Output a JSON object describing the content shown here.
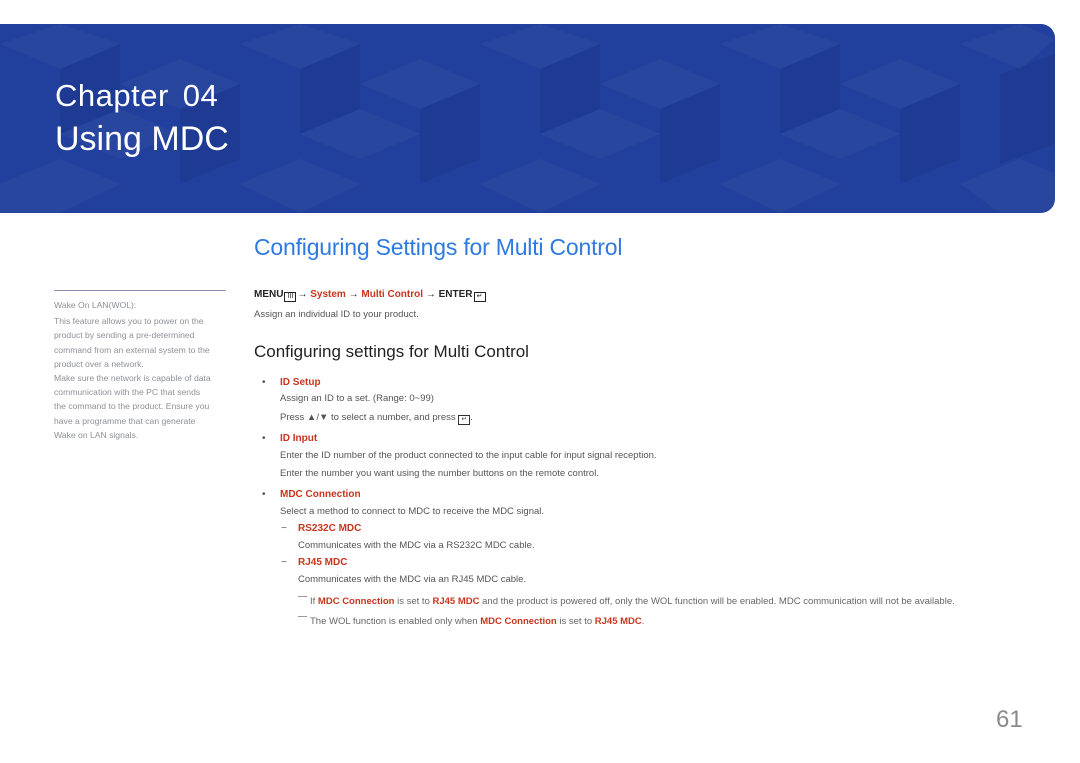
{
  "banner": {
    "chapter_label": "Chapter",
    "chapter_number": "04",
    "title": "Using MDC",
    "bg_color": "#213f9c"
  },
  "sidebar": {
    "lines": [
      "Wake On LAN(WOL):",
      "This feature allows you to power on the",
      "product by sending a pre-determined",
      "command from an external system to the",
      "product over a network.",
      "Make sure the network is capable of data",
      "communication with the PC that sends",
      "the command to the product. Ensure you",
      "have a programme that can generate",
      "Wake on LAN signals."
    ]
  },
  "main": {
    "heading": "Configuring Settings for Multi Control",
    "menu_path": {
      "menu": "MENU",
      "menu_icon": "III",
      "arrow": "→",
      "system": "System",
      "multi_control": "Multi Control",
      "enter": "ENTER",
      "enter_icon": "↵"
    },
    "description": "Assign an individual ID to your product.",
    "subheading": "Configuring settings for Multi Control",
    "bullet_char": "•",
    "items": [
      {
        "label": "ID Setup",
        "lines": [
          "Assign an ID to a set. (Range: 0~99)",
          "Press ▲/▼ to select a number, and press"
        ]
      },
      {
        "label": "ID Input",
        "lines": [
          "Enter the ID number of the product connected to the input cable for input signal reception.",
          "Enter the number you want using the number buttons on the remote control."
        ]
      },
      {
        "label": "MDC Connection",
        "lines": [
          "Select a method to connect to MDC to receive the MDC signal."
        ],
        "subitems": [
          {
            "label": "RS232C MDC",
            "text": "Communicates with the MDC via a RS232C MDC cable."
          },
          {
            "label": "RJ45 MDC",
            "text": "Communicates with the MDC via an RJ45 MDC cable."
          }
        ]
      }
    ],
    "dash_char": "−",
    "notes": {
      "n1_a": "If",
      "n1_b": "MDC Connection",
      "n1_c": "is set to",
      "n1_d": "RJ45 MDC",
      "n1_e": "and the product is powered off, only the WOL function will be enabled. MDC communication will not be available.",
      "n2_a": "The WOL function is enabled only when",
      "n2_b": "MDC Connection",
      "n2_c": "is set to",
      "n2_d": "RJ45 MDC",
      "n2_e": "."
    },
    "accent_color": "#c9341e",
    "heading_color": "#2f7ae0"
  },
  "page_number": "61"
}
